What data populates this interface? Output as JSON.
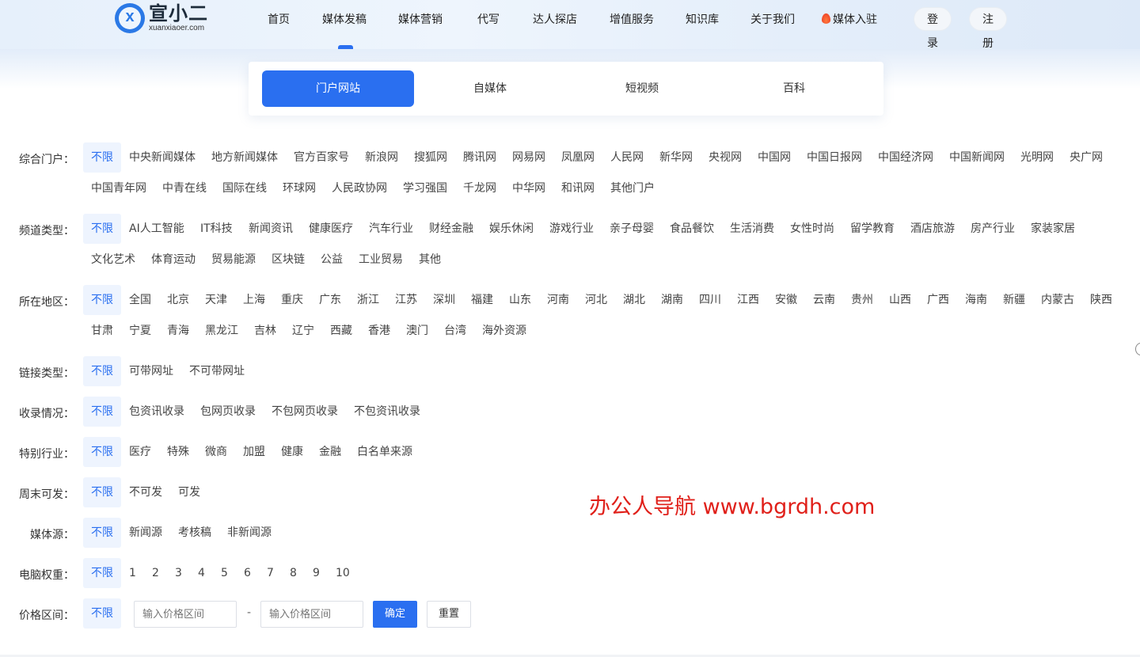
{
  "logo": {
    "name": "宣小二",
    "domain": "xuanxiaoer.com"
  },
  "nav": {
    "items": [
      "首页",
      "媒体发稿",
      "媒体营销",
      "代写",
      "达人探店",
      "增值服务",
      "知识库",
      "关于我们",
      "媒体入驻"
    ],
    "login": "登录",
    "register": "注册"
  },
  "tabs": [
    "门户网站",
    "自媒体",
    "短视频",
    "百科"
  ],
  "filters": {
    "portal": {
      "label": "综合门户：",
      "options": [
        "不限",
        "中央新闻媒体",
        "地方新闻媒体",
        "官方百家号",
        "新浪网",
        "搜狐网",
        "腾讯网",
        "网易网",
        "凤凰网",
        "人民网",
        "新华网",
        "央视网",
        "中国网",
        "中国日报网",
        "中国经济网",
        "中国新闻网",
        "光明网",
        "央广网",
        "中国青年网",
        "中青在线",
        "国际在线",
        "环球网",
        "人民政协网",
        "学习强国",
        "千龙网",
        "中华网",
        "和讯网",
        "其他门户"
      ]
    },
    "channel": {
      "label": "频道类型：",
      "options": [
        "不限",
        "AI人工智能",
        "IT科技",
        "新闻资讯",
        "健康医疗",
        "汽车行业",
        "财经金融",
        "娱乐休闲",
        "游戏行业",
        "亲子母婴",
        "食品餐饮",
        "生活消费",
        "女性时尚",
        "留学教育",
        "酒店旅游",
        "房产行业",
        "家装家居",
        "文化艺术",
        "体育运动",
        "贸易能源",
        "区块链",
        "公益",
        "工业贸易",
        "其他"
      ]
    },
    "region": {
      "label": "所在地区：",
      "options": [
        "不限",
        "全国",
        "北京",
        "天津",
        "上海",
        "重庆",
        "广东",
        "浙江",
        "江苏",
        "深圳",
        "福建",
        "山东",
        "河南",
        "河北",
        "湖北",
        "湖南",
        "四川",
        "江西",
        "安徽",
        "云南",
        "贵州",
        "山西",
        "广西",
        "海南",
        "新疆",
        "内蒙古",
        "陕西",
        "甘肃",
        "宁夏",
        "青海",
        "黑龙江",
        "吉林",
        "辽宁",
        "西藏",
        "香港",
        "澳门",
        "台湾",
        "海外资源"
      ]
    },
    "link": {
      "label": "链接类型：",
      "options": [
        "不限",
        "可带网址",
        "不可带网址"
      ]
    },
    "index": {
      "label": "收录情况：",
      "options": [
        "不限",
        "包资讯收录",
        "包网页收录",
        "不包网页收录",
        "不包资讯收录"
      ]
    },
    "industry": {
      "label": "特别行业：",
      "options": [
        "不限",
        "医疗",
        "特殊",
        "微商",
        "加盟",
        "健康",
        "金融",
        "白名单来源"
      ]
    },
    "weekend": {
      "label": "周末可发：",
      "options": [
        "不限",
        "不可发",
        "可发"
      ]
    },
    "source": {
      "label": "媒体源：",
      "options": [
        "不限",
        "新闻源",
        "考核稿",
        "非新闻源"
      ]
    },
    "weight": {
      "label": "电脑权重：",
      "options": [
        "不限",
        "1",
        "2",
        "3",
        "4",
        "5",
        "6",
        "7",
        "8",
        "9",
        "10"
      ]
    },
    "price": {
      "label": "价格区间：",
      "options": [
        "不限"
      ],
      "min_placeholder": "输入价格区间",
      "max_placeholder": "输入价格区间",
      "separator": "-",
      "confirm": "确定",
      "reset": "重置"
    }
  },
  "watermark": "办公人导航 www.bgrdh.com",
  "colors": {
    "accent": "#2a6ff0",
    "selected_bg": "#eef4fe",
    "watermark": "#e0201a"
  }
}
